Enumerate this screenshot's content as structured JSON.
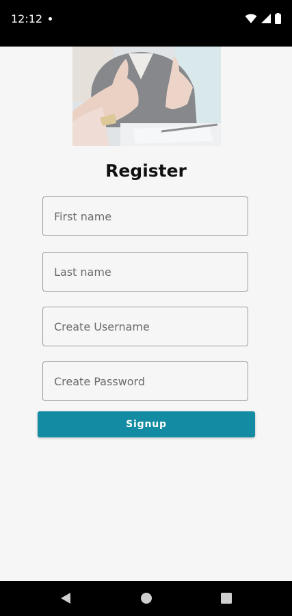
{
  "status_bar": {
    "time": "12:12",
    "icons": [
      "notification-dot-icon",
      "wifi-icon",
      "signal-icon",
      "battery-icon"
    ]
  },
  "register": {
    "title": "Register",
    "hero_image": "handshake-photo",
    "fields": {
      "first_name": {
        "value": "",
        "placeholder": "First name"
      },
      "last_name": {
        "value": "",
        "placeholder": "Last name"
      },
      "username": {
        "value": "",
        "placeholder": "Create Username"
      },
      "password": {
        "value": "",
        "placeholder": "Create Password"
      }
    },
    "signup_label": "Signup"
  },
  "colors": {
    "background": "#f6f6f6",
    "accent": "#128ba3",
    "title_text": "#111111",
    "field_border": "#9a9a9a"
  },
  "nav_bar": {
    "buttons": [
      "back-icon",
      "home-icon",
      "recents-icon"
    ]
  }
}
